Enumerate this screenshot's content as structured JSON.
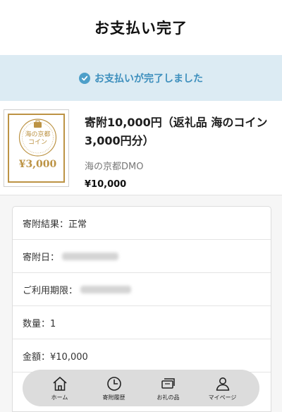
{
  "header": {
    "title": "お支払い完了"
  },
  "banner": {
    "icon": "check-circle-icon",
    "message": "お支払いが完了しました",
    "color": "#3d8fbd",
    "background": "#dcebf3"
  },
  "product": {
    "thumbnail": {
      "line1": "海の京都",
      "line2": "コイン",
      "amount": "¥3,000",
      "color": "#bc9344"
    },
    "name": "寄附10,000円（返礼品 海のコイン3,000円分）",
    "vendor": "海の京都DMO",
    "price": "¥10,000"
  },
  "details": {
    "result": "寄附結果：正常",
    "date_label": "寄附日：",
    "period_label": "ご利用期限：",
    "quantity": "数量：1",
    "amount": "金額：¥10,000"
  },
  "nav": {
    "items": [
      {
        "label": "ホーム",
        "icon": "home-icon"
      },
      {
        "label": "寄附履歴",
        "icon": "clock-icon"
      },
      {
        "label": "お礼の品",
        "icon": "ticket-icon"
      },
      {
        "label": "マイページ",
        "icon": "user-icon"
      }
    ]
  }
}
